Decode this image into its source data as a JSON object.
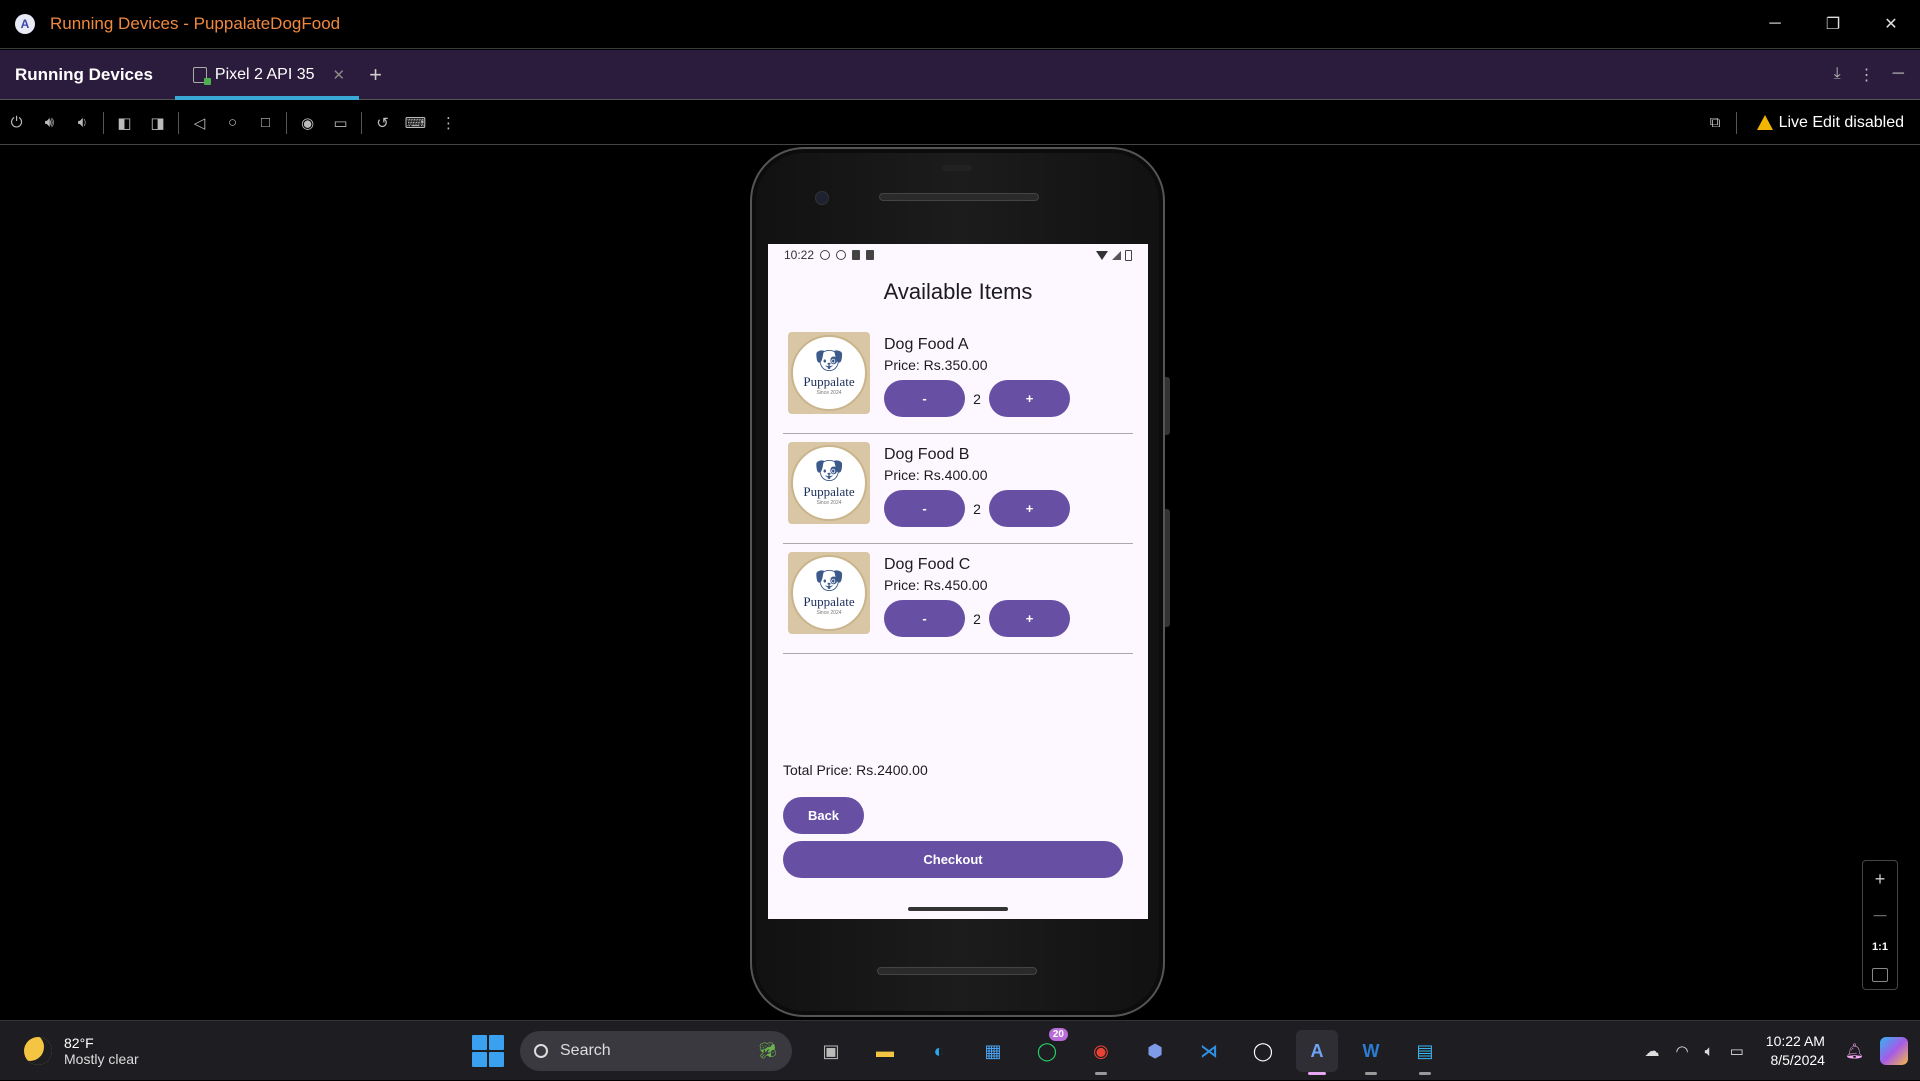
{
  "window": {
    "title": "Running Devices - PuppalateDogFood"
  },
  "tool_window": {
    "title": "Running Devices",
    "tab_label": "Pixel 2 API 35",
    "live_edit": "Live Edit disabled"
  },
  "zoom": {
    "one_to_one": "1:1"
  },
  "device": {
    "status_time": "10:22",
    "screen_title": "Available Items",
    "items": [
      {
        "name": "Dog Food A",
        "price": "Price: Rs.350.00",
        "qty": "2",
        "minus": "-",
        "plus": "+",
        "logo_text": "Puppalate",
        "logo_since": "Since 2024"
      },
      {
        "name": "Dog Food B",
        "price": "Price: Rs.400.00",
        "qty": "2",
        "minus": "-",
        "plus": "+",
        "logo_text": "Puppalate",
        "logo_since": "Since 2024"
      },
      {
        "name": "Dog Food C",
        "price": "Price: Rs.450.00",
        "qty": "2",
        "minus": "-",
        "plus": "+",
        "logo_text": "Puppalate",
        "logo_since": "Since 2024"
      }
    ],
    "total": "Total Price: Rs.2400.00",
    "back_label": "Back",
    "checkout_label": "Checkout",
    "accent_color": "#6750a4"
  },
  "taskbar": {
    "weather_temp": "82°F",
    "weather_desc": "Mostly clear",
    "search_placeholder": "Search",
    "whatsapp_badge": "20",
    "clock_time": "10:22 AM",
    "clock_date": "8/5/2024"
  }
}
